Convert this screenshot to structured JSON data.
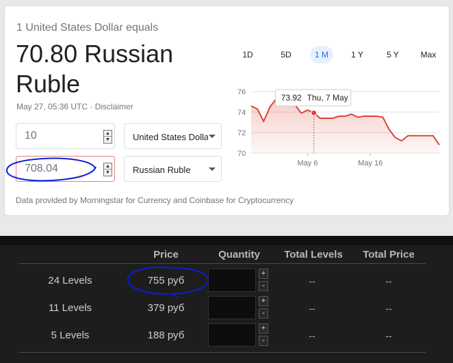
{
  "converter": {
    "equals_text": "1 United States Dollar equals",
    "result_text": "70.80 Russian Ruble",
    "timestamp": "May 27, 05:36 UTC",
    "separator": " · ",
    "disclaimer": "Disclaimer",
    "from_amount": "10",
    "to_amount": "708.04",
    "from_currency": "United States Dollar",
    "to_currency": "Russian Ruble",
    "footer": "Data provided by Morningstar for Currency and Coinbase for Cryptocurrency",
    "ranges": [
      "1D",
      "5D",
      "1 M",
      "1 Y",
      "5 Y",
      "Max"
    ],
    "selected_range": "1 M",
    "icons": {
      "spin": "stepper-arrows-icon",
      "dropdown": "chevron-down-icon"
    }
  },
  "chart_data": {
    "type": "line",
    "x": [
      "Apr 27",
      "Apr 28",
      "Apr 29",
      "Apr 30",
      "May 1",
      "May 2",
      "May 3",
      "May 4",
      "May 5",
      "May 6",
      "May 7",
      "May 8",
      "May 9",
      "May 10",
      "May 11",
      "May 12",
      "May 13",
      "May 14",
      "May 15",
      "May 16",
      "May 17",
      "May 18",
      "May 19",
      "May 20",
      "May 21",
      "May 22",
      "May 23",
      "May 24",
      "May 25",
      "May 26",
      "May 27"
    ],
    "values": [
      74.6,
      74.3,
      73.1,
      74.5,
      75.3,
      75.6,
      75.4,
      74.7,
      73.9,
      74.2,
      73.92,
      73.4,
      73.4,
      73.4,
      73.6,
      73.6,
      73.8,
      73.5,
      73.6,
      73.6,
      73.6,
      73.5,
      72.3,
      71.5,
      71.2,
      71.7,
      71.7,
      71.7,
      71.7,
      71.7,
      70.8
    ],
    "yticks": [
      70,
      72,
      74,
      76
    ],
    "xticks": [
      "May 6",
      "May 16"
    ],
    "ylim": [
      70,
      76
    ],
    "grid": true,
    "color": "#db4437",
    "tooltip": {
      "value": "73.92",
      "date": "Thu, 7 May"
    }
  },
  "store": {
    "headers": {
      "price": "Price",
      "quantity": "Quantity",
      "total_levels": "Total Levels",
      "total_price": "Total Price"
    },
    "rows": [
      {
        "label": "24 Levels",
        "price": "755 руб",
        "total_levels": "--",
        "total_price": "--"
      },
      {
        "label": "11 Levels",
        "price": "379 руб",
        "total_levels": "--",
        "total_price": "--"
      },
      {
        "label": "5 Levels",
        "price": "188 руб",
        "total_levels": "--",
        "total_price": "--"
      }
    ],
    "plus": "+",
    "minus": "-"
  },
  "annotations": {
    "circle_color": "#0a1fd6"
  }
}
